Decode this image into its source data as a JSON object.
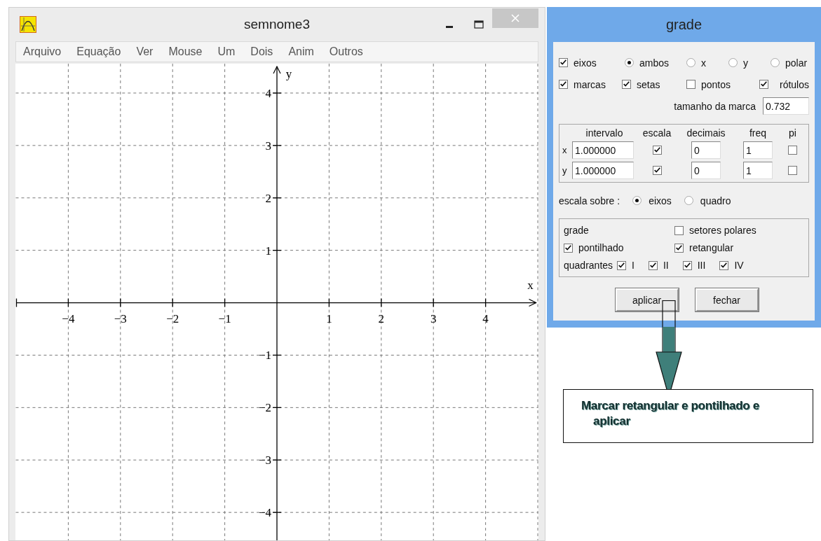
{
  "window": {
    "title": "semnome3"
  },
  "menu": [
    "Arquivo",
    "Equação",
    "Ver",
    "Mouse",
    "Um",
    "Dois",
    "Anim",
    "Outros"
  ],
  "graph": {
    "x_label": "x",
    "y_label": "y",
    "x_ticks": [
      "−4",
      "−3",
      "−2",
      "−1",
      "1",
      "2",
      "3",
      "4"
    ],
    "y_ticks": [
      "4",
      "3",
      "2",
      "1",
      "−1",
      "−2",
      "−3",
      "−4"
    ]
  },
  "dialog": {
    "title": "grade",
    "axes_options": [
      {
        "kind": "checkbox",
        "label": "eixos",
        "checked": true
      },
      {
        "kind": "radio",
        "label": "ambos",
        "selected": true
      },
      {
        "kind": "radio",
        "label": "x",
        "selected": false
      },
      {
        "kind": "radio",
        "label": "y",
        "selected": false
      },
      {
        "kind": "radio",
        "label": "polar",
        "selected": false
      }
    ],
    "mark_options": [
      {
        "label": "marcas",
        "checked": true
      },
      {
        "label": "setas",
        "checked": true
      },
      {
        "label": "pontos",
        "checked": false
      },
      {
        "label": "rótulos",
        "checked": true
      }
    ],
    "tick_size": {
      "label": "tamanho da marca",
      "value": "0.732"
    },
    "scale_table": {
      "columns": [
        "intervalo",
        "escala",
        "decimais",
        "freq",
        "pi"
      ],
      "rows": [
        {
          "axis": "x",
          "interval": "1.000000",
          "scale": true,
          "decimals": "0",
          "freq": "1",
          "pi": false
        },
        {
          "axis": "y",
          "interval": "1.000000",
          "scale": true,
          "decimals": "0",
          "freq": "1",
          "pi": false
        }
      ]
    },
    "scale_on": {
      "label": "escala sobre :",
      "options": [
        {
          "label": "eixos",
          "selected": true
        },
        {
          "label": "quadro",
          "selected": false
        }
      ]
    },
    "grid_group": {
      "title": "grade",
      "options": [
        {
          "label": "setores polares",
          "checked": false
        },
        {
          "label": "pontilhado",
          "checked": true
        },
        {
          "label": "retangular",
          "checked": true
        }
      ],
      "quadrants_label": "quadrantes",
      "quadrants": [
        {
          "label": "I",
          "checked": true
        },
        {
          "label": "II",
          "checked": true
        },
        {
          "label": "III",
          "checked": true
        },
        {
          "label": "IV",
          "checked": true
        }
      ]
    },
    "buttons": [
      "aplicar",
      "fechar"
    ]
  },
  "callout": {
    "text": "Marcar retangular e pontilhado e aplicar"
  }
}
